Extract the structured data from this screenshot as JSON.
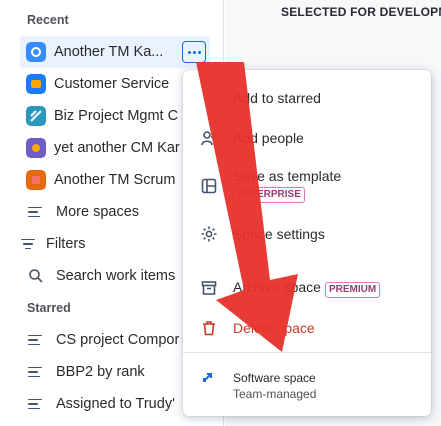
{
  "sidebar": {
    "recent_label": "Recent",
    "recent_items": [
      {
        "label": "Another TM Ka...",
        "icon": "project-avatar-blue-icon",
        "color": "#388bff"
      },
      {
        "label": "Customer Service",
        "icon": "project-avatar-teal-icon",
        "color": "#1d7afc"
      },
      {
        "label": "Biz Project Mgmt C",
        "icon": "project-avatar-cyan-icon",
        "color": "#2898bd"
      },
      {
        "label": "yet another CM Kar",
        "icon": "project-avatar-purple-icon",
        "color": "#6e5dc6"
      },
      {
        "label": "Another TM Scrum",
        "icon": "project-avatar-orange-icon",
        "color": "#e56910"
      }
    ],
    "more_spaces": "More spaces",
    "filters": "Filters",
    "search_work_items": "Search work items",
    "starred_label": "Starred",
    "starred_items": [
      {
        "label": "CS project Compor"
      },
      {
        "label": "BBP2 by rank"
      },
      {
        "label": "Assigned to Trudy'"
      }
    ]
  },
  "board": {
    "column_title": "SELECTED FOR DEVELOPMI"
  },
  "menu": {
    "add_to_starred": "Add to starred",
    "add_people": "Add people",
    "save_as_template": "Save as template",
    "enterprise_badge": "ENTERPRISE",
    "space_settings": "Space settings",
    "archive_space": "Archive space",
    "premium_badge": "PREMIUM",
    "delete_space": "Delete space",
    "footer_title": "Software space",
    "footer_subtitle": "Team-managed"
  },
  "colors": {
    "accent": "#1868db",
    "danger": "#c9372c",
    "annotation_arrow": "#e8302a"
  }
}
